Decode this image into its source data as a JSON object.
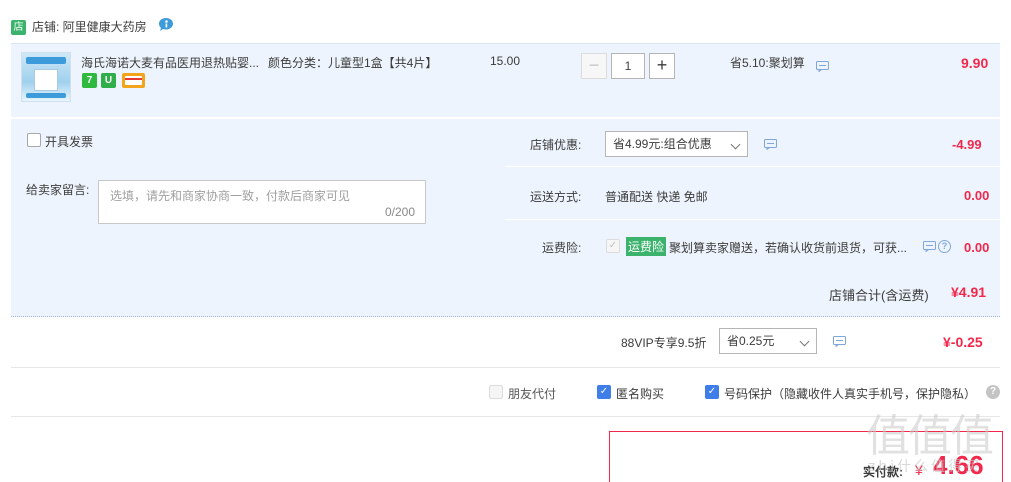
{
  "store": {
    "icon_text": "店",
    "label": "店铺: 阿里健康大药房"
  },
  "item": {
    "title": "海氏海诺大麦有品医用退热贴婴...",
    "spec": "颜色分类：儿童型1盒【共4片】",
    "unit_price": "15.00",
    "quantity": "1",
    "minus": "−",
    "plus": "+",
    "promo": "省5.10:聚划算",
    "total": "9.90",
    "badge_seven": "7",
    "badge_g": "U"
  },
  "services": {
    "invoice_label": "开具发票",
    "note_label": "给卖家留言:",
    "note_placeholder": "选填，请先和商家协商一致，付款后商家可见",
    "note_count": "0/200",
    "store_discount_label": "店铺优惠:",
    "store_discount_value": "省4.99元:组合优惠",
    "store_discount_amount": "-4.99",
    "shipping_label": "运送方式:",
    "shipping_value": "普通配送 快递 免邮",
    "shipping_amount": "0.00",
    "freight_label": "运费险:",
    "freight_tag": "运费险",
    "freight_text": "聚划算卖家赠送，若确认收货前退货，可获...",
    "freight_amount": "0.00"
  },
  "store_total": {
    "label": "店铺合计(含运费)",
    "amount": "¥4.91"
  },
  "vip": {
    "label": "88VIP专享9.5折",
    "select_value": "省0.25元",
    "amount": "¥-0.25"
  },
  "options": {
    "friend_pay": "朋友代付",
    "anonymous": "匿名购买",
    "number_protect": "号码保护（隐藏收件人真实手机号，保护隐私）"
  },
  "payment": {
    "label": "实付款:",
    "currency": "¥",
    "amount": "4.66"
  },
  "watermark": {
    "main": "值值值",
    "sub": "zhi什么值得买"
  },
  "colors": {
    "accent_red": "#f1284b",
    "panel_bg": "#eef4fd",
    "checkbox_blue": "#3f7de8",
    "tag_green": "#3bb36c"
  }
}
